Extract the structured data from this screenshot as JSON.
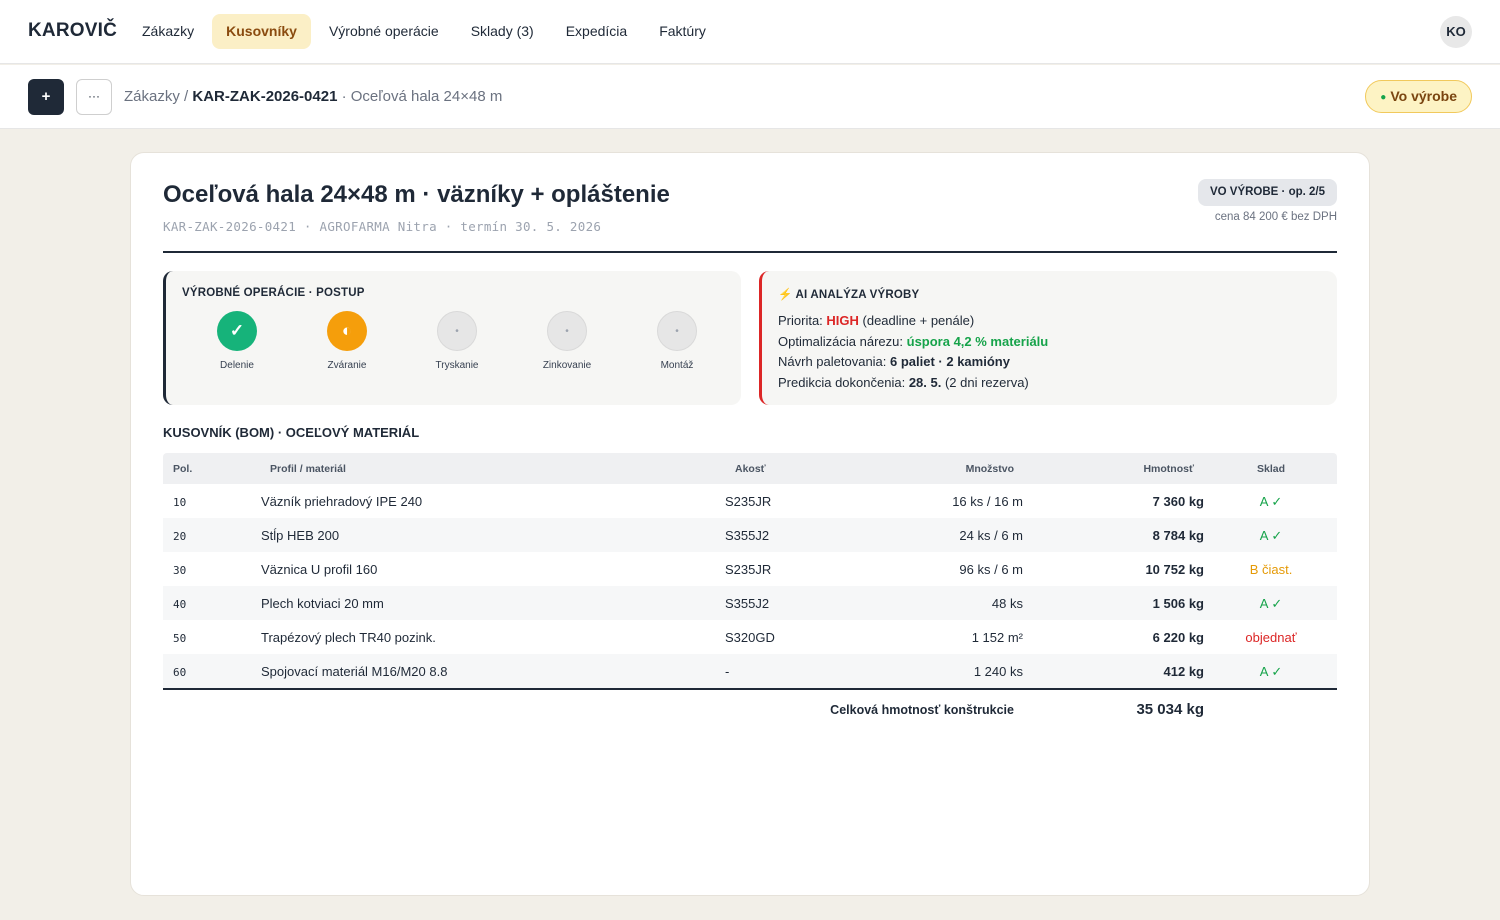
{
  "app": {
    "brand": "KAROVIČ",
    "user_initials": "KO"
  },
  "nav": [
    {
      "label": "Zákazky",
      "active": false
    },
    {
      "label": "Kusovníky",
      "active": true
    },
    {
      "label": "Výrobné operácie",
      "active": false
    },
    {
      "label": "Sklady (3)",
      "active": false
    },
    {
      "label": "Expedícia",
      "active": false
    },
    {
      "label": "Faktúry",
      "active": false
    }
  ],
  "toolbar": {
    "add_label": "+",
    "more_label": "···"
  },
  "breadcrumb": {
    "root": "Zákazky",
    "sep": " / ",
    "code": "KAR-ZAK-2026-0421",
    "desc": " · Oceľová hala 24×48 m"
  },
  "status": {
    "label": "Vo výrobe",
    "dot": "●"
  },
  "order": {
    "title": "Oceľová hala 24×48 m · väzníky + opláštenie",
    "meta": "KAR-ZAK-2026-0421 · AGROFARMA Nitra · termín 30. 5. 2026",
    "phase_badge": "VO VÝROBE · op. 2/5",
    "price": "cena 84 200 € bez DPH"
  },
  "operations": {
    "heading": "VÝROBNÉ OPERÁCIE · POSTUP",
    "steps": [
      {
        "label": "Delenie",
        "state": "done",
        "glyph": "✓"
      },
      {
        "label": "Zváranie",
        "state": "in-progress",
        "glyph": "◐"
      },
      {
        "label": "Tryskanie",
        "state": "todo",
        "glyph": "•"
      },
      {
        "label": "Zinkovanie",
        "state": "todo",
        "glyph": "•"
      },
      {
        "label": "Montáž",
        "state": "todo",
        "glyph": "•"
      }
    ]
  },
  "ai": {
    "heading": "⚡ AI ANALÝZA VÝROBY",
    "priority_label": "Priorita: ",
    "priority_value": "HIGH",
    "priority_note": " (deadline + penále)",
    "cut_label": "Optimalizácia nárezu: ",
    "cut_value": "úspora 4,2 % materiálu",
    "pallet_label": "Návrh paletovania: ",
    "pallet_value": "6 paliet · 2 kamióny",
    "finish_label": "Predikcia dokončenia: ",
    "finish_value": "28. 5.",
    "finish_note": " (2 dni rezerva)"
  },
  "bom": {
    "heading": "KUSOVNÍK (BOM) · OCEĽOVÝ MATERIÁL",
    "columns": {
      "pos": "Pol.",
      "material": "Profil / materiál",
      "grade": "Akosť",
      "qty": "Množstvo",
      "weight": "Hmotnosť",
      "stock": "Sklad"
    },
    "rows": [
      {
        "pos": "10",
        "material": "Väzník priehradový IPE 240",
        "grade": "S235JR",
        "qty": "16 ks / 16 m",
        "weight": "7 360 kg",
        "stock": "A ✓",
        "stock_state": "ok"
      },
      {
        "pos": "20",
        "material": "Stĺp HEB 200",
        "grade": "S355J2",
        "qty": "24 ks / 6 m",
        "weight": "8 784 kg",
        "stock": "A ✓",
        "stock_state": "ok"
      },
      {
        "pos": "30",
        "material": "Väznica U profil 160",
        "grade": "S235JR",
        "qty": "96 ks / 6 m",
        "weight": "10 752 kg",
        "stock": "B čiast.",
        "stock_state": "partial"
      },
      {
        "pos": "40",
        "material": "Plech kotviaci 20 mm",
        "grade": "S355J2",
        "qty": "48 ks",
        "weight": "1 506 kg",
        "stock": "A ✓",
        "stock_state": "ok"
      },
      {
        "pos": "50",
        "material": "Trapézový plech TR40 pozink.",
        "grade": "S320GD",
        "qty": "1 152 m²",
        "weight": "6 220 kg",
        "stock": "objednať",
        "stock_state": "order"
      },
      {
        "pos": "60",
        "material": "Spojovací materiál M16/M20 8.8",
        "grade": "-",
        "qty": "1 240 ks",
        "weight": "412 kg",
        "stock": "A ✓",
        "stock_state": "ok"
      }
    ],
    "total_label": "Celková hmotnosť konštrukcie",
    "total_value": "35 034 kg"
  }
}
